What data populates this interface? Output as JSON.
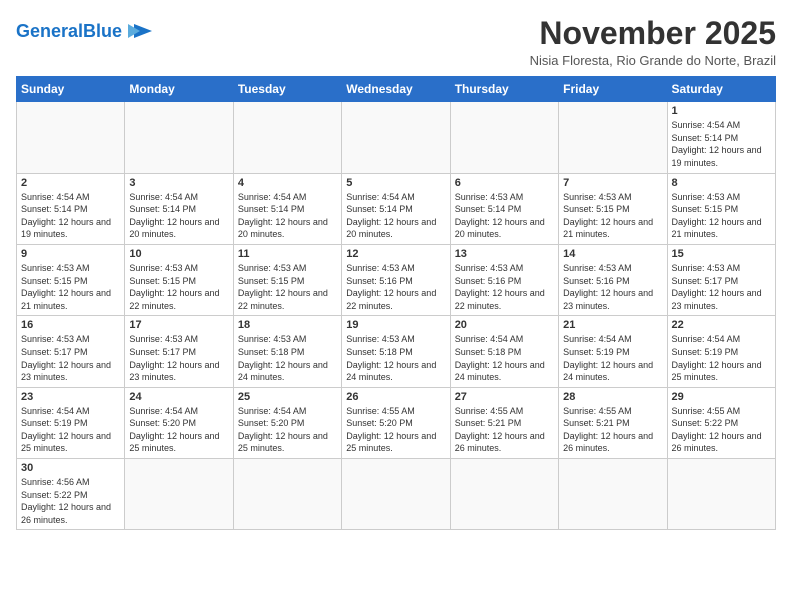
{
  "header": {
    "logo_general": "General",
    "logo_blue": "Blue",
    "month_title": "November 2025",
    "subtitle": "Nisia Floresta, Rio Grande do Norte, Brazil"
  },
  "weekdays": [
    "Sunday",
    "Monday",
    "Tuesday",
    "Wednesday",
    "Thursday",
    "Friday",
    "Saturday"
  ],
  "days": [
    {
      "date": "",
      "info": ""
    },
    {
      "date": "",
      "info": ""
    },
    {
      "date": "",
      "info": ""
    },
    {
      "date": "",
      "info": ""
    },
    {
      "date": "",
      "info": ""
    },
    {
      "date": "",
      "info": ""
    },
    {
      "date": "1",
      "info": "Sunrise: 4:54 AM\nSunset: 5:14 PM\nDaylight: 12 hours and 19 minutes."
    },
    {
      "date": "2",
      "info": "Sunrise: 4:54 AM\nSunset: 5:14 PM\nDaylight: 12 hours and 19 minutes."
    },
    {
      "date": "3",
      "info": "Sunrise: 4:54 AM\nSunset: 5:14 PM\nDaylight: 12 hours and 20 minutes."
    },
    {
      "date": "4",
      "info": "Sunrise: 4:54 AM\nSunset: 5:14 PM\nDaylight: 12 hours and 20 minutes."
    },
    {
      "date": "5",
      "info": "Sunrise: 4:54 AM\nSunset: 5:14 PM\nDaylight: 12 hours and 20 minutes."
    },
    {
      "date": "6",
      "info": "Sunrise: 4:53 AM\nSunset: 5:14 PM\nDaylight: 12 hours and 20 minutes."
    },
    {
      "date": "7",
      "info": "Sunrise: 4:53 AM\nSunset: 5:15 PM\nDaylight: 12 hours and 21 minutes."
    },
    {
      "date": "8",
      "info": "Sunrise: 4:53 AM\nSunset: 5:15 PM\nDaylight: 12 hours and 21 minutes."
    },
    {
      "date": "9",
      "info": "Sunrise: 4:53 AM\nSunset: 5:15 PM\nDaylight: 12 hours and 21 minutes."
    },
    {
      "date": "10",
      "info": "Sunrise: 4:53 AM\nSunset: 5:15 PM\nDaylight: 12 hours and 22 minutes."
    },
    {
      "date": "11",
      "info": "Sunrise: 4:53 AM\nSunset: 5:15 PM\nDaylight: 12 hours and 22 minutes."
    },
    {
      "date": "12",
      "info": "Sunrise: 4:53 AM\nSunset: 5:16 PM\nDaylight: 12 hours and 22 minutes."
    },
    {
      "date": "13",
      "info": "Sunrise: 4:53 AM\nSunset: 5:16 PM\nDaylight: 12 hours and 22 minutes."
    },
    {
      "date": "14",
      "info": "Sunrise: 4:53 AM\nSunset: 5:16 PM\nDaylight: 12 hours and 23 minutes."
    },
    {
      "date": "15",
      "info": "Sunrise: 4:53 AM\nSunset: 5:17 PM\nDaylight: 12 hours and 23 minutes."
    },
    {
      "date": "16",
      "info": "Sunrise: 4:53 AM\nSunset: 5:17 PM\nDaylight: 12 hours and 23 minutes."
    },
    {
      "date": "17",
      "info": "Sunrise: 4:53 AM\nSunset: 5:17 PM\nDaylight: 12 hours and 23 minutes."
    },
    {
      "date": "18",
      "info": "Sunrise: 4:53 AM\nSunset: 5:18 PM\nDaylight: 12 hours and 24 minutes."
    },
    {
      "date": "19",
      "info": "Sunrise: 4:53 AM\nSunset: 5:18 PM\nDaylight: 12 hours and 24 minutes."
    },
    {
      "date": "20",
      "info": "Sunrise: 4:54 AM\nSunset: 5:18 PM\nDaylight: 12 hours and 24 minutes."
    },
    {
      "date": "21",
      "info": "Sunrise: 4:54 AM\nSunset: 5:19 PM\nDaylight: 12 hours and 24 minutes."
    },
    {
      "date": "22",
      "info": "Sunrise: 4:54 AM\nSunset: 5:19 PM\nDaylight: 12 hours and 25 minutes."
    },
    {
      "date": "23",
      "info": "Sunrise: 4:54 AM\nSunset: 5:19 PM\nDaylight: 12 hours and 25 minutes."
    },
    {
      "date": "24",
      "info": "Sunrise: 4:54 AM\nSunset: 5:20 PM\nDaylight: 12 hours and 25 minutes."
    },
    {
      "date": "25",
      "info": "Sunrise: 4:54 AM\nSunset: 5:20 PM\nDaylight: 12 hours and 25 minutes."
    },
    {
      "date": "26",
      "info": "Sunrise: 4:55 AM\nSunset: 5:20 PM\nDaylight: 12 hours and 25 minutes."
    },
    {
      "date": "27",
      "info": "Sunrise: 4:55 AM\nSunset: 5:21 PM\nDaylight: 12 hours and 26 minutes."
    },
    {
      "date": "28",
      "info": "Sunrise: 4:55 AM\nSunset: 5:21 PM\nDaylight: 12 hours and 26 minutes."
    },
    {
      "date": "29",
      "info": "Sunrise: 4:55 AM\nSunset: 5:22 PM\nDaylight: 12 hours and 26 minutes."
    },
    {
      "date": "30",
      "info": "Sunrise: 4:56 AM\nSunset: 5:22 PM\nDaylight: 12 hours and 26 minutes."
    },
    {
      "date": "",
      "info": ""
    },
    {
      "date": "",
      "info": ""
    },
    {
      "date": "",
      "info": ""
    },
    {
      "date": "",
      "info": ""
    },
    {
      "date": "",
      "info": ""
    },
    {
      "date": "",
      "info": ""
    }
  ]
}
